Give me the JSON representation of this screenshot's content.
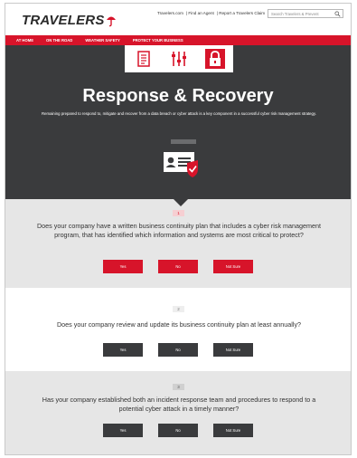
{
  "header": {
    "logo_text": "TRAVELERS",
    "utility_links": [
      "Travelers.com",
      "Find an Agent",
      "Report a Travelers Claim"
    ],
    "search_placeholder": "Search Travelers & Prevent",
    "brand_color": "#d7142a"
  },
  "nav": {
    "items": [
      "AT HOME",
      "ON THE ROAD",
      "WEATHER SAFETY",
      "PROTECT YOUR BUSINESS"
    ]
  },
  "hero": {
    "icons": [
      "checklist-icon",
      "sliders-icon",
      "lock-icon"
    ],
    "title": "Response & Recovery",
    "description": "Remaining prepared to respond to, mitigate and recover from a data breach or cyber attack is a key component in a successful cyber risk management strategy.",
    "illustration": "id-card-shield-icon"
  },
  "questions": [
    {
      "number": "1",
      "text": "Does your company have a written business continuity plan that includes a cyber risk management program, that has identified which information and systems are most critical to protect?",
      "buttons": [
        "Yes",
        "No",
        "Not Sure"
      ]
    },
    {
      "number": "2",
      "text": "Does your company review and update its business continuity plan at least annually?",
      "buttons": [
        "Yes",
        "No",
        "Not Sure"
      ]
    },
    {
      "number": "3",
      "text": "Has your company established both an incident response team and procedures to respond to a potential cyber attack in a timely manner?",
      "buttons": [
        "Yes",
        "No",
        "Not Sure"
      ]
    }
  ]
}
